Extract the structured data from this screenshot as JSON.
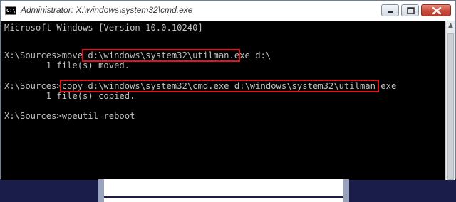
{
  "window": {
    "title": "Administrator: X:\\windows\\system32\\cmd.exe",
    "icon_label": "C:\\",
    "caption_buttons": [
      "minimize-icon",
      "maximize-icon",
      "close-icon"
    ]
  },
  "console": {
    "lines": [
      "Microsoft Windows [Version 10.0.10240]",
      "",
      "",
      "X:\\Sources>move d:\\windows\\system32\\utilman.exe d:\\",
      "        1 file(s) moved.",
      "",
      "X:\\Sources>copy d:\\windows\\system32\\cmd.exe d:\\windows\\system32\\utilman.exe",
      "        1 file(s) copied.",
      "",
      "X:\\Sources>wpeutil reboot"
    ],
    "highlights": [
      "d:\\windows\\system32\\utilman.exe",
      "copy d:\\windows\\system32\\cmd.exe d:\\windows\\system32\\utilman.exe"
    ]
  },
  "colors": {
    "console_bg": "#000000",
    "console_text": "#c0c0c0",
    "highlight_border": "#e0141a",
    "desktop_bg": "#1a1d4a"
  }
}
